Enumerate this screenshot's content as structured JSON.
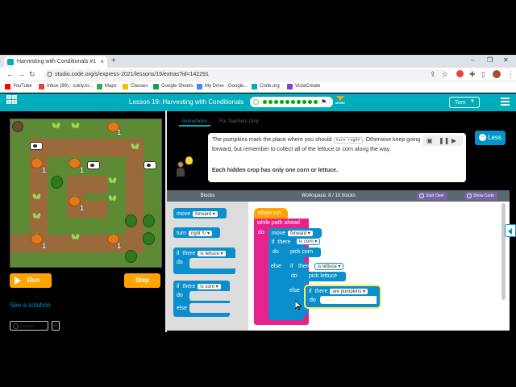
{
  "browser": {
    "tab_title": "Harvesting with Conditionals #1",
    "url": "studio.code.org/s/express-2021/lessons/19/extras?id=142291",
    "bookmarks": [
      "YouTube",
      "Inbox (89) - sokly.to...",
      "Maps",
      "Classes",
      "Google Sheets",
      "My Drive - Google...",
      "Code.org",
      "VistaCreate"
    ]
  },
  "header": {
    "lesson_title": "Lesson 19: Harvesting with Conditionals",
    "more_label": "MORE",
    "user_name": "Tom"
  },
  "maze": {
    "counts": [
      "1",
      "1",
      "1",
      "1",
      "1",
      "1",
      "1",
      "1"
    ]
  },
  "controls": {
    "run_label": "Run",
    "step_label": "Step",
    "see_solution": "See a solution",
    "language": "English",
    "id_label": "ID"
  },
  "instructions": {
    "tabs": [
      "Instructions",
      "For Teachers Only"
    ],
    "text_before": "The pumpkins mark the place where you should ",
    "code_ref": "turn right",
    "text_after": ". Otherwise keep going forward, but remember to collect all of the lettuce or corn along the way.",
    "bold_text": "Each hidden crop has only one corn or lettuce.",
    "less_label": "Less",
    "hint_count": "2"
  },
  "workspace": {
    "blocks_label": "Blocks",
    "title": "Workspace: 8 / 10 blocks",
    "start_over": "Start Over",
    "show_code": "Show Code"
  },
  "toolbox": {
    "move": "move",
    "move_dir": "forward ▾",
    "turn": "turn",
    "turn_dir": "right ↻ ▾",
    "if1_if": "if",
    "if1_there": "there",
    "if1_cond": "is lettuce ▾",
    "if1_do": "do",
    "if2_if": "if",
    "if2_there": "there",
    "if2_cond": "is corn ▾",
    "if2_do": "do",
    "if2_else": "else"
  },
  "program": {
    "when_run": "when run",
    "while": "while path ahead",
    "do": "do",
    "move": "move",
    "move_dir": "forward ▾",
    "if_corn_if": "if",
    "if_corn_there": "there",
    "if_corn_cond": "is corn ▾",
    "do2": "do",
    "pick_corn": "pick corn",
    "else1": "else",
    "if_lettuce_if": "if",
    "if_lettuce_there": "there",
    "if_lettuce_cond": "is lettuce ▾",
    "do3": "do",
    "pick_lettuce": "pick lettuce",
    "else2": "else",
    "if_pump_if": "if",
    "if_pump_there": "there",
    "if_pump_cond": "are pumpkins ▾",
    "do4": "do"
  }
}
